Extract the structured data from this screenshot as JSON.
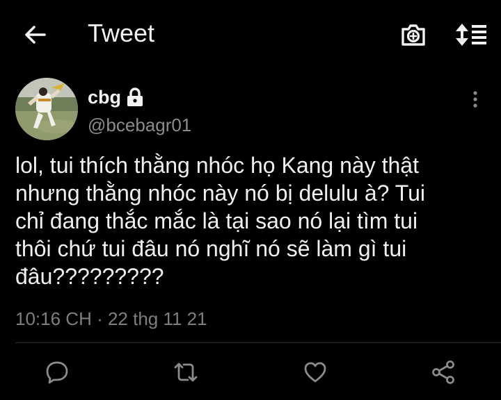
{
  "header": {
    "title": "Tweet",
    "back_icon": "arrow-left-icon",
    "camera_icon": "camera-icon",
    "sort_icon": "sort-icon"
  },
  "author": {
    "display_name": "cbg",
    "handle": "@bcebagr01",
    "protected_icon": "lock-icon"
  },
  "tweet": {
    "text": "lol, tui thích thằng nhóc họ Kang này thật\nnhưng thằng nhóc này nó bị delulu à? Tui\nchỉ đang thắc mắc là tại sao nó lại tìm tui\nthôi chứ tui đâu nó nghĩ nó sẽ làm gì tui\nđâu?????????",
    "timestamp": "10:16 CH · 22 thg 11 21"
  },
  "actions": {
    "reply_icon": "reply-icon",
    "retweet_icon": "retweet-icon",
    "like_icon": "heart-icon",
    "share_icon": "share-icon"
  },
  "colors": {
    "background": "#000000",
    "text_primary": "#f0f0f0",
    "text_secondary": "#8b8b8b",
    "divider": "#2a2a2a"
  }
}
